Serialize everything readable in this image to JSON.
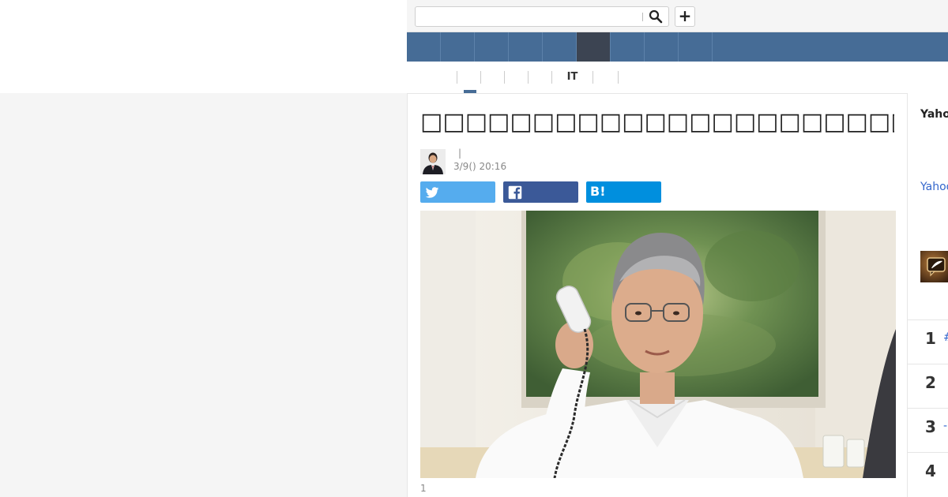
{
  "header": {
    "search": {
      "value": "",
      "placeholder": ""
    }
  },
  "nav": {
    "items": [
      "",
      "",
      "",
      "",
      "",
      "",
      "",
      "",
      ""
    ]
  },
  "subnav": {
    "items": [
      "",
      "",
      "",
      "",
      "",
      "IT",
      ""
    ]
  },
  "article": {
    "title": "□□□□□□□□□□□□□□□□□□□□□□□□□□□□□□□□□□□□□",
    "author_separator": "|",
    "author_name": "",
    "date": "3/9() 20:16",
    "share": {
      "hatena_label": "B!"
    },
    "caption": "1"
  },
  "sidebar": {
    "title": "Yahoo",
    "link": "Yahoo",
    "ranking": [
      {
        "rank": "1",
        "extra": "#"
      },
      {
        "rank": "2",
        "extra": ""
      },
      {
        "rank": "3",
        "extra": "-"
      },
      {
        "rank": "4",
        "extra": ""
      }
    ]
  },
  "colors": {
    "nav_bg": "#466c96",
    "nav_active": "#3c4452",
    "twitter": "#55acee",
    "facebook": "#3b5998",
    "hatena": "#008fde",
    "link": "#3366cc"
  },
  "icons": [
    "search-icon",
    "plus-icon",
    "twitter-icon",
    "facebook-icon",
    "hatena-icon",
    "comment-icon"
  ]
}
